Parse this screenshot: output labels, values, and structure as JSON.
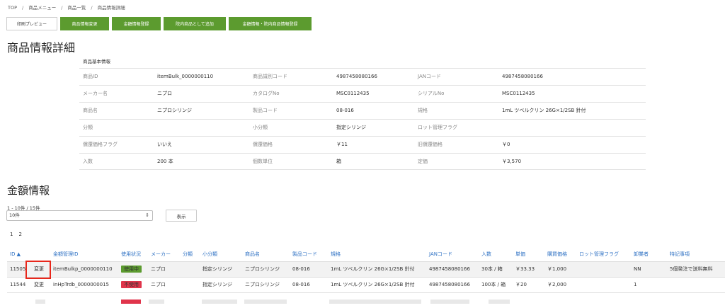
{
  "breadcrumb": [
    "TOP",
    "商品メニュー",
    "商品一覧",
    "商品情報詳細"
  ],
  "breadcrumb_sep": "/",
  "toolbar": {
    "print": "印刷プレビュー",
    "edit_product": "商品情報変更",
    "register_price": "金額情報登録",
    "add_inhouse": "院内商品として追加",
    "register_both": "金額情報・院内商品情報登録"
  },
  "title": "商品情報詳細",
  "basic_caption": "商品基本情報",
  "basic_rows": [
    [
      [
        "商品ID",
        "itemBulk_0000000110"
      ],
      [
        "商品識別コード",
        "4987458080166"
      ],
      [
        "JANコード",
        "4987458080166"
      ]
    ],
    [
      [
        "メーカー名",
        "ニプロ"
      ],
      [
        "カタログNo",
        "MSC0112435"
      ],
      [
        "シリアルNo",
        "MSC0112435"
      ]
    ],
    [
      [
        "商品名",
        "ニプロシリンジ"
      ],
      [
        "製品コード",
        "08-016"
      ],
      [
        "規格",
        "1mL ツベルクリン 26G×1/2SB 針付"
      ]
    ],
    [
      [
        "分類",
        ""
      ],
      [
        "小分類",
        "指定シリンジ"
      ],
      [
        "ロット管理フラグ",
        ""
      ]
    ],
    [
      [
        "償還価格フラグ",
        "いいえ"
      ],
      [
        "償還価格",
        "￥11"
      ],
      [
        "旧償還価格",
        "￥0"
      ]
    ],
    [
      [
        "入数",
        "200 本"
      ],
      [
        "個数単位",
        "箱"
      ],
      [
        "定価",
        "￥3,570"
      ]
    ]
  ],
  "price_title": "金額情報",
  "count": "1 - 10件 / 15件",
  "page_size": "10件",
  "show_button": "表示",
  "pages": [
    "1",
    "2"
  ],
  "price_headers": [
    "ID ▲",
    "金額管理ID",
    "使用状況",
    "メーカー",
    "分類",
    "小分類",
    "商品名",
    "製品コード",
    "規格",
    "JANコード",
    "入数",
    "単価",
    "購買価格",
    "ロット管理フラグ",
    "卸業者",
    "特記事項"
  ],
  "price_rows": [
    {
      "id": "11505",
      "edit": "変更",
      "mgmt_id": "itemBulkp_0000000110",
      "status": "使用中",
      "status_kind": "on",
      "maker": "ニプロ",
      "sub": "指定シリンジ",
      "name": "ニプロシリンジ",
      "code": "08-016",
      "spec": "1mL ツベルクリン 26G×1/2SB 針付",
      "jan": "4987458080166",
      "qty": "30本 / 箱",
      "unit": "￥33.33",
      "buy": "￥1,000",
      "wholesaler": "NN",
      "note": "5個発注で送料無料"
    },
    {
      "id": "11544",
      "edit": "変更",
      "mgmt_id": "inHpTrdb_0000000015",
      "status": "不使用",
      "status_kind": "off",
      "maker": "ニプロ",
      "sub": "指定シリンジ",
      "name": "ニプロシリンジ",
      "code": "08-016",
      "spec": "1mL ツベルクリン 26G×1/2SB 針付",
      "jan": "4987458080166",
      "qty": "100本 / 箱",
      "unit": "￥20",
      "buy": "￥2,000",
      "wholesaler": "1",
      "note": ""
    }
  ],
  "colors": {
    "green": "#5c9b2f",
    "link": "#2f72c4",
    "red_badge": "#e0344b",
    "highlight": "#e8271b"
  }
}
